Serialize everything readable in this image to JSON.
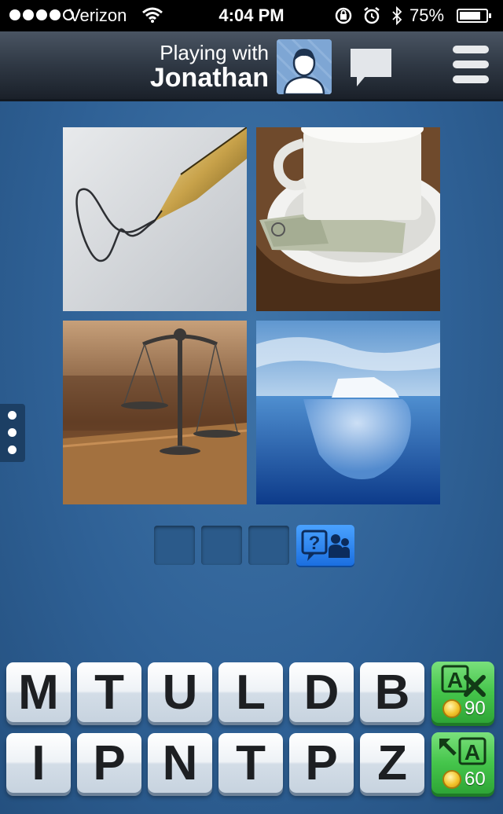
{
  "status_bar": {
    "carrier": "Verizon",
    "time": "4:04 PM",
    "battery_text": "75%",
    "signal_bars": 4,
    "battery_level": 0.75,
    "icons": [
      "wifi-icon",
      "rotation-lock-icon",
      "alarm-icon",
      "bluetooth-icon",
      "battery-icon"
    ]
  },
  "header": {
    "playing_with": "Playing with",
    "opponent_name": "Jonathan",
    "avatar_icon": "avatar-silhouette-icon",
    "chat_icon": "chat-bubble-icon",
    "menu_icon": "hamburger-menu-icon"
  },
  "puzzle": {
    "images": [
      {
        "subject": "fountain pen signing"
      },
      {
        "subject": "coffee cup with tip money"
      },
      {
        "subject": "scales of justice"
      },
      {
        "subject": "iceberg"
      }
    ],
    "answer_slots": [
      "",
      "",
      ""
    ],
    "ask_friend_icon": "ask-friend-icon"
  },
  "keyboard": {
    "row1": [
      "M",
      "T",
      "U",
      "L",
      "D",
      "B"
    ],
    "row2": [
      "I",
      "P",
      "N",
      "T",
      "P",
      "Z"
    ],
    "powerups": [
      {
        "name": "remove-letters",
        "label": "A",
        "cost": "90"
      },
      {
        "name": "reveal-letter",
        "label": "A",
        "cost": "60"
      }
    ]
  },
  "colors": {
    "background": "#2f6196",
    "header": "#2f3844",
    "tile": "#eef2f6",
    "powerup": "#45c54b",
    "ask_button": "#1b6fe0"
  }
}
